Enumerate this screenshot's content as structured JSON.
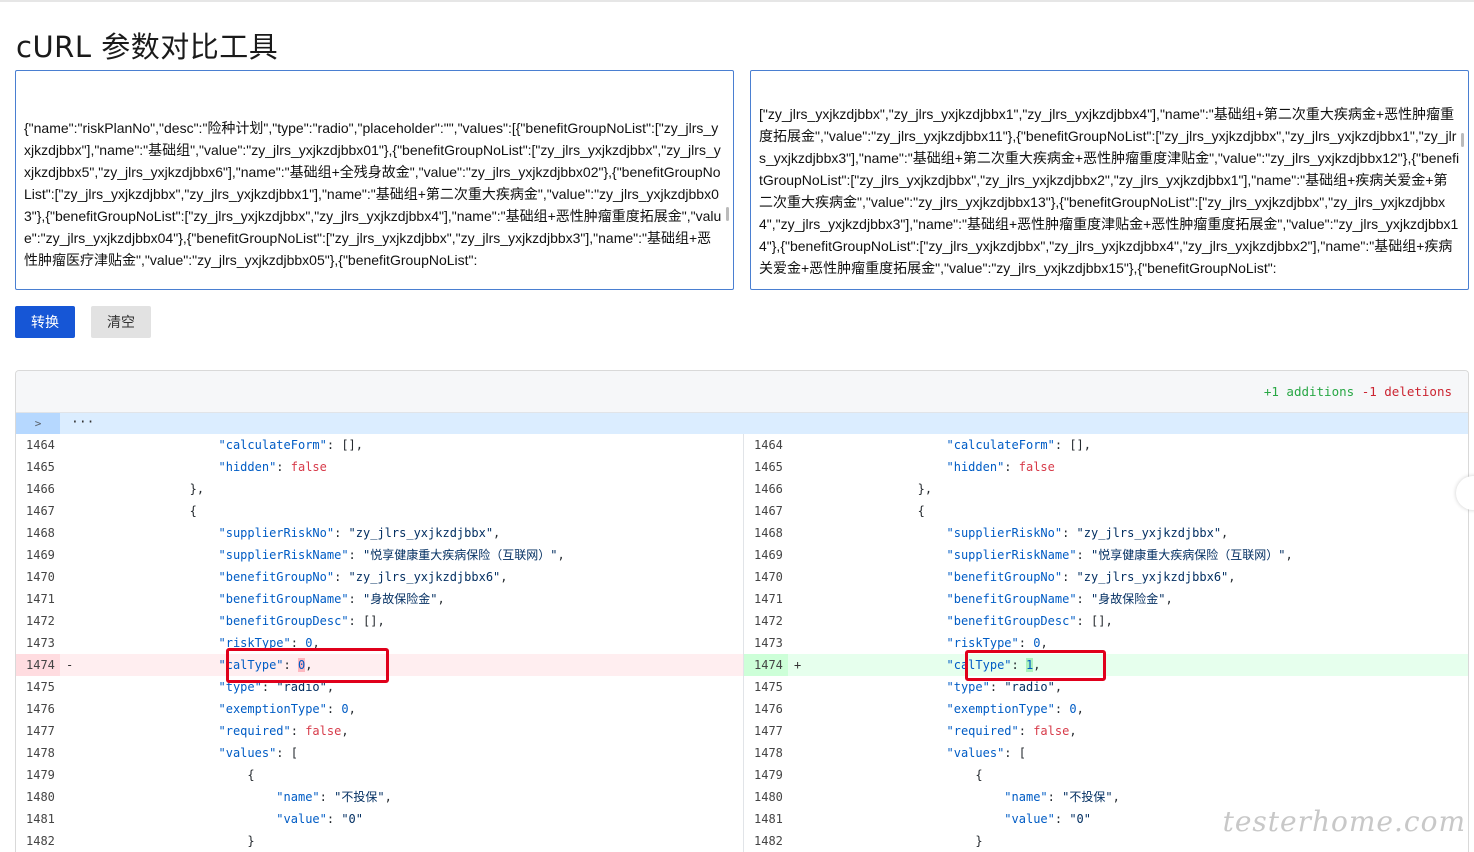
{
  "page": {
    "title": "cURL 参数对比工具"
  },
  "inputs": {
    "left_text": "{\"name\":\"riskPlanNo\",\"desc\":\"险种计划\",\"type\":\"radio\",\"placeholder\":\"\",\"values\":[{\"benefitGroupNoList\":[\"zy_jlrs_yxjkzdjbbx\"],\"name\":\"基础组\",\"value\":\"zy_jlrs_yxjkzdjbbx01\"},{\"benefitGroupNoList\":[\"zy_jlrs_yxjkzdjbbx\",\"zy_jlrs_yxjkzdjbbx5\",\"zy_jlrs_yxjkzdjbbx6\"],\"name\":\"基础组+全残身故金\",\"value\":\"zy_jlrs_yxjkzdjbbx02\"},{\"benefitGroupNoList\":[\"zy_jlrs_yxjkzdjbbx\",\"zy_jlrs_yxjkzdjbbx1\"],\"name\":\"基础组+第二次重大疾病金\",\"value\":\"zy_jlrs_yxjkzdjbbx03\"},{\"benefitGroupNoList\":[\"zy_jlrs_yxjkzdjbbx\",\"zy_jlrs_yxjkzdjbbx4\"],\"name\":\"基础组+恶性肿瘤重度拓展金\",\"value\":\"zy_jlrs_yxjkzdjbbx04\"},{\"benefitGroupNoList\":[\"zy_jlrs_yxjkzdjbbx\",\"zy_jlrs_yxjkzdjbbx3\"],\"name\":\"基础组+恶性肿瘤医疗津贴金\",\"value\":\"zy_jlrs_yxjkzdjbbx05\"},{\"benefitGroupNoList\":",
    "right_text": "[\"zy_jlrs_yxjkzdjbbx\",\"zy_jlrs_yxjkzdjbbx1\",\"zy_jlrs_yxjkzdjbbx4\"],\"name\":\"基础组+第二次重大疾病金+恶性肿瘤重度拓展金\",\"value\":\"zy_jlrs_yxjkzdjbbx11\"},{\"benefitGroupNoList\":[\"zy_jlrs_yxjkzdjbbx\",\"zy_jlrs_yxjkzdjbbx1\",\"zy_jlrs_yxjkzdjbbx3\"],\"name\":\"基础组+第二次重大疾病金+恶性肿瘤重度津贴金\",\"value\":\"zy_jlrs_yxjkzdjbbx12\"},{\"benefitGroupNoList\":[\"zy_jlrs_yxjkzdjbbx\",\"zy_jlrs_yxjkzdjbbx2\",\"zy_jlrs_yxjkzdjbbx1\"],\"name\":\"基础组+疾病关爱金+第二次重大疾病金\",\"value\":\"zy_jlrs_yxjkzdjbbx13\"},{\"benefitGroupNoList\":[\"zy_jlrs_yxjkzdjbbx\",\"zy_jlrs_yxjkzdjbbx4\",\"zy_jlrs_yxjkzdjbbx3\"],\"name\":\"基础组+恶性肿瘤重度津贴金+恶性肿瘤重度拓展金\",\"value\":\"zy_jlrs_yxjkzdjbbx14\"},{\"benefitGroupNoList\":[\"zy_jlrs_yxjkzdjbbx\",\"zy_jlrs_yxjkzdjbbx4\",\"zy_jlrs_yxjkzdjbbx2\"],\"name\":\"基础组+疾病关爱金+恶性肿瘤重度拓展金\",\"value\":\"zy_jlrs_yxjkzdjbbx15\"},{\"benefitGroupNoList\":"
  },
  "buttons": {
    "convert": "转换",
    "clear": "清空"
  },
  "diff": {
    "additions": "+1 additions",
    "deletions": "-1 deletions",
    "hunk_expand": ">",
    "hunk_dots": "···",
    "colors": {
      "del_bg": "#ffeef0",
      "add_bg": "#e6ffed",
      "highlight": "#e0001b"
    },
    "left_rows": [
      {
        "ln": "1464",
        "mk": "",
        "code": "                    \"calculateForm\": [],"
      },
      {
        "ln": "1465",
        "mk": "",
        "code": "                    \"hidden\": false"
      },
      {
        "ln": "1466",
        "mk": "",
        "code": "                },"
      },
      {
        "ln": "1467",
        "mk": "",
        "code": "                {"
      },
      {
        "ln": "1468",
        "mk": "",
        "code": "                    \"supplierRiskNo\": \"zy_jlrs_yxjkzdjbbx\","
      },
      {
        "ln": "1469",
        "mk": "",
        "code": "                    \"supplierRiskName\": \"悦享健康重大疾病保险（互联网）\","
      },
      {
        "ln": "1470",
        "mk": "",
        "code": "                    \"benefitGroupNo\": \"zy_jlrs_yxjkzdjbbx6\","
      },
      {
        "ln": "1471",
        "mk": "",
        "code": "                    \"benefitGroupName\": \"身故保险金\","
      },
      {
        "ln": "1472",
        "mk": "",
        "code": "                    \"benefitGroupDesc\": [],"
      },
      {
        "ln": "1473",
        "mk": "",
        "code": "                    \"riskType\": 0,"
      },
      {
        "ln": "1474",
        "mk": "-",
        "code": "                    \"calType\": 0,",
        "type": "del"
      },
      {
        "ln": "1475",
        "mk": "",
        "code": "                    \"type\": \"radio\","
      },
      {
        "ln": "1476",
        "mk": "",
        "code": "                    \"exemptionType\": 0,"
      },
      {
        "ln": "1477",
        "mk": "",
        "code": "                    \"required\": false,"
      },
      {
        "ln": "1478",
        "mk": "",
        "code": "                    \"values\": ["
      },
      {
        "ln": "1479",
        "mk": "",
        "code": "                        {"
      },
      {
        "ln": "1480",
        "mk": "",
        "code": "                            \"name\": \"不投保\","
      },
      {
        "ln": "1481",
        "mk": "",
        "code": "                            \"value\": \"0\""
      },
      {
        "ln": "1482",
        "mk": "",
        "code": "                        }"
      }
    ],
    "right_rows": [
      {
        "ln": "1464",
        "mk": "",
        "code": "                    \"calculateForm\": [],"
      },
      {
        "ln": "1465",
        "mk": "",
        "code": "                    \"hidden\": false"
      },
      {
        "ln": "1466",
        "mk": "",
        "code": "                },"
      },
      {
        "ln": "1467",
        "mk": "",
        "code": "                {"
      },
      {
        "ln": "1468",
        "mk": "",
        "code": "                    \"supplierRiskNo\": \"zy_jlrs_yxjkzdjbbx\","
      },
      {
        "ln": "1469",
        "mk": "",
        "code": "                    \"supplierRiskName\": \"悦享健康重大疾病保险（互联网）\","
      },
      {
        "ln": "1470",
        "mk": "",
        "code": "                    \"benefitGroupNo\": \"zy_jlrs_yxjkzdjbbx6\","
      },
      {
        "ln": "1471",
        "mk": "",
        "code": "                    \"benefitGroupName\": \"身故保险金\","
      },
      {
        "ln": "1472",
        "mk": "",
        "code": "                    \"benefitGroupDesc\": [],"
      },
      {
        "ln": "1473",
        "mk": "",
        "code": "                    \"riskType\": 0,"
      },
      {
        "ln": "1474",
        "mk": "+",
        "code": "                    \"calType\": 1,",
        "type": "add"
      },
      {
        "ln": "1475",
        "mk": "",
        "code": "                    \"type\": \"radio\","
      },
      {
        "ln": "1476",
        "mk": "",
        "code": "                    \"exemptionType\": 0,"
      },
      {
        "ln": "1477",
        "mk": "",
        "code": "                    \"required\": false,"
      },
      {
        "ln": "1478",
        "mk": "",
        "code": "                    \"values\": ["
      },
      {
        "ln": "1479",
        "mk": "",
        "code": "                        {"
      },
      {
        "ln": "1480",
        "mk": "",
        "code": "                            \"name\": \"不投保\","
      },
      {
        "ln": "1481",
        "mk": "",
        "code": "                            \"value\": \"0\""
      },
      {
        "ln": "1482",
        "mk": "",
        "code": "                        }"
      }
    ]
  },
  "watermark": "testerhome.com"
}
